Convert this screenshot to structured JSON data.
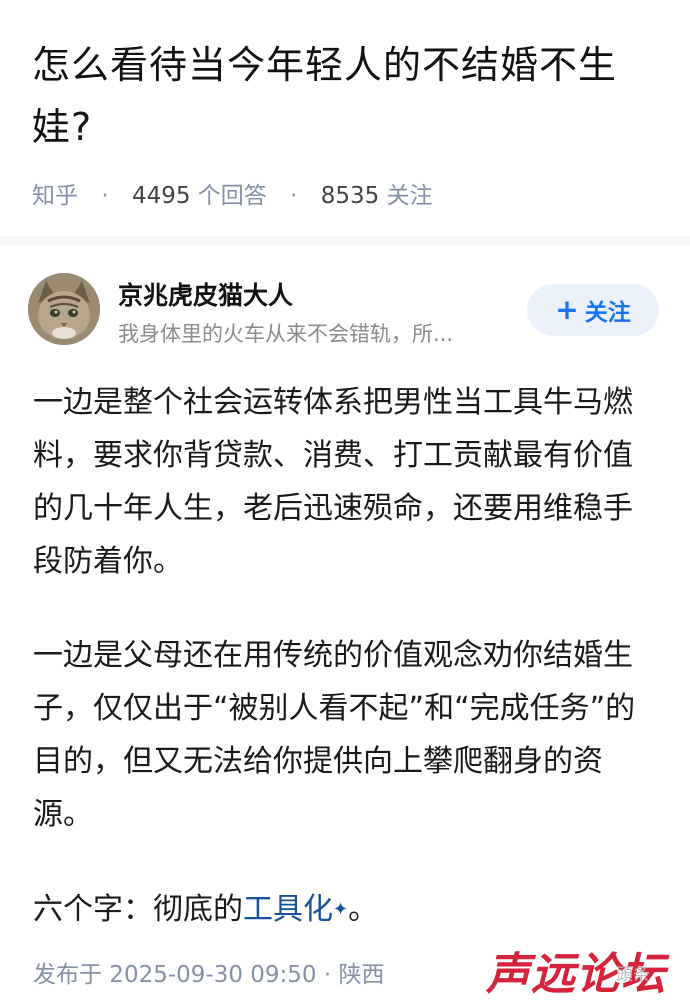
{
  "question": {
    "title": "怎么看待当今年轻人的不结婚不生娃?",
    "source": "知乎",
    "answers_count": "4495",
    "answers_label": "个回答",
    "followers_count": "8535",
    "followers_label": "关注"
  },
  "author": {
    "name": "京兆虎皮猫大人",
    "bio": "我身体里的火车从来不会错轨，所...",
    "follow_label": "关注"
  },
  "answer": {
    "paragraph1": "一边是整个社会运转体系把男性当工具牛马燃料，要求你背贷款、消费、打工贡献最有价值的几十年人生，老后迅速殒命，还要用维稳手段防着你。",
    "paragraph2": "一边是父母还在用传统的价值观念劝你结婚生子，仅仅出于“被别人看不起”和“完成任务”的目的，但又无法给你提供向上攀爬翻身的资源。",
    "paragraph3_prefix": "六个字：彻底的",
    "paragraph3_term": "工具化",
    "paragraph3_suffix": "。"
  },
  "footer": {
    "published": "发布于  2025-09-30  09:50 · 陕西"
  },
  "watermark": {
    "text": "声远论坛",
    "faint": "頭条"
  },
  "colors": {
    "accent": "#1772f6",
    "meta": "#8590a6",
    "term_link": "#175199",
    "watermark": "#d4233a"
  }
}
